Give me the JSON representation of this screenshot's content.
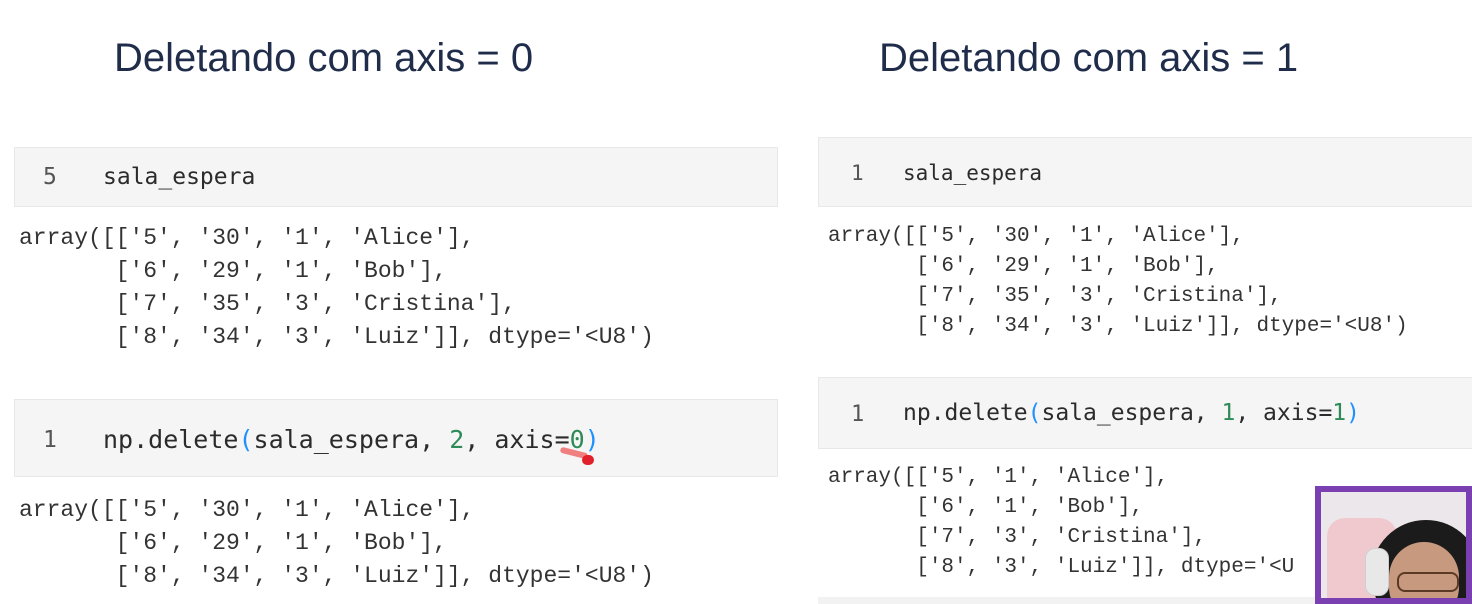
{
  "slide": {
    "left_title": "Deletando com axis = 0",
    "right_title": "Deletando com axis = 1"
  },
  "left": {
    "cell1": {
      "line_number": "5",
      "code": "sala_espera"
    },
    "output1": [
      "array([['5', '30', '1', 'Alice'],",
      "       ['6', '29', '1', 'Bob'],",
      "       ['7', '35', '3', 'Cristina'],",
      "       ['8', '34', '3', 'Luiz']], dtype='<U8')"
    ],
    "cell2": {
      "line_number": "1",
      "code_prefix": "np.delete",
      "open_paren": "(",
      "arg_name": "sala_espera, ",
      "index": "2",
      "axis_label": ", axis=",
      "axis_value": "0",
      "close_paren": ")"
    },
    "output2": [
      "array([['5', '30', '1', 'Alice'],",
      "       ['6', '29', '1', 'Bob'],",
      "       ['8', '34', '3', 'Luiz']], dtype='<U8')"
    ]
  },
  "right": {
    "cell1": {
      "line_number": "1",
      "code": "sala_espera"
    },
    "output1": [
      "array([['5', '30', '1', 'Alice'],",
      "       ['6', '29', '1', 'Bob'],",
      "       ['7', '35', '3', 'Cristina'],",
      "       ['8', '34', '3', 'Luiz']], dtype='<U8')"
    ],
    "cell2": {
      "line_number": "1",
      "code_prefix": "np.delete",
      "open_paren": "(",
      "arg_name": "sala_espera, ",
      "index": "1",
      "axis_label": ", axis=",
      "axis_value": "1",
      "close_paren": ")"
    },
    "output2": [
      "array([['5', '1', 'Alice'],",
      "       ['6', '1', 'Bob'],",
      "       ['7', '3', 'Cristina'],",
      "       ['8', '3', 'Luiz']], dtype='<U"
    ]
  },
  "colors": {
    "title": "#1f2d4b",
    "paren": "#1e90ff",
    "number": "#2e8b57",
    "webcam_border": "#7a3fb0",
    "cursor": "#e0202a"
  }
}
